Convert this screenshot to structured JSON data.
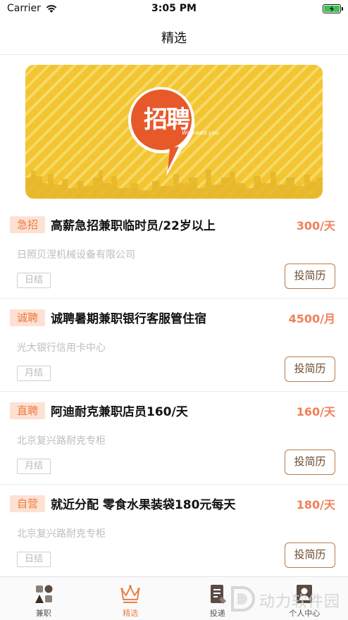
{
  "status": {
    "carrier": "Carrier",
    "time": "3:05 PM"
  },
  "nav": {
    "title": "精选"
  },
  "banner": {
    "logo_text": "招聘",
    "logo_subtext": "We need you"
  },
  "jobs": [
    {
      "tag": "急招",
      "title": "高薪急招兼职临时员/22岁以上",
      "salary": "300/天",
      "company": "日照贝涅机械设备有限公司",
      "pay_cycle": "日结",
      "apply": "投简历"
    },
    {
      "tag": "诚聘",
      "title": "诚聘暑期兼职银行客服管住宿",
      "salary": "4500/月",
      "company": "光大银行信用卡中心",
      "pay_cycle": "月结",
      "apply": "投简历"
    },
    {
      "tag": "直聘",
      "title": "阿迪耐克兼职店员160/天",
      "salary": "160/天",
      "company": "北京复兴路耐克专柜",
      "pay_cycle": "月结",
      "apply": "投简历"
    },
    {
      "tag": "自营",
      "title": "就近分配 零食水果装袋180元每天",
      "salary": "180/天",
      "company": "北京复兴路耐克专柜",
      "pay_cycle": "日结",
      "apply": "投简历"
    }
  ],
  "tabs": [
    {
      "label": "兼职",
      "icon": "grid-shapes-icon"
    },
    {
      "label": "精选",
      "icon": "crown-icon"
    },
    {
      "label": "投递",
      "icon": "document-icon"
    },
    {
      "label": "个人中心",
      "icon": "person-icon"
    }
  ],
  "watermark": {
    "text": "动力软件园"
  },
  "colors": {
    "accent": "#e8824b",
    "tag_bg": "#fde1d3",
    "salary": "#f0805a",
    "banner_yellow": "#f2c531",
    "logo_orange": "#e8592a"
  }
}
